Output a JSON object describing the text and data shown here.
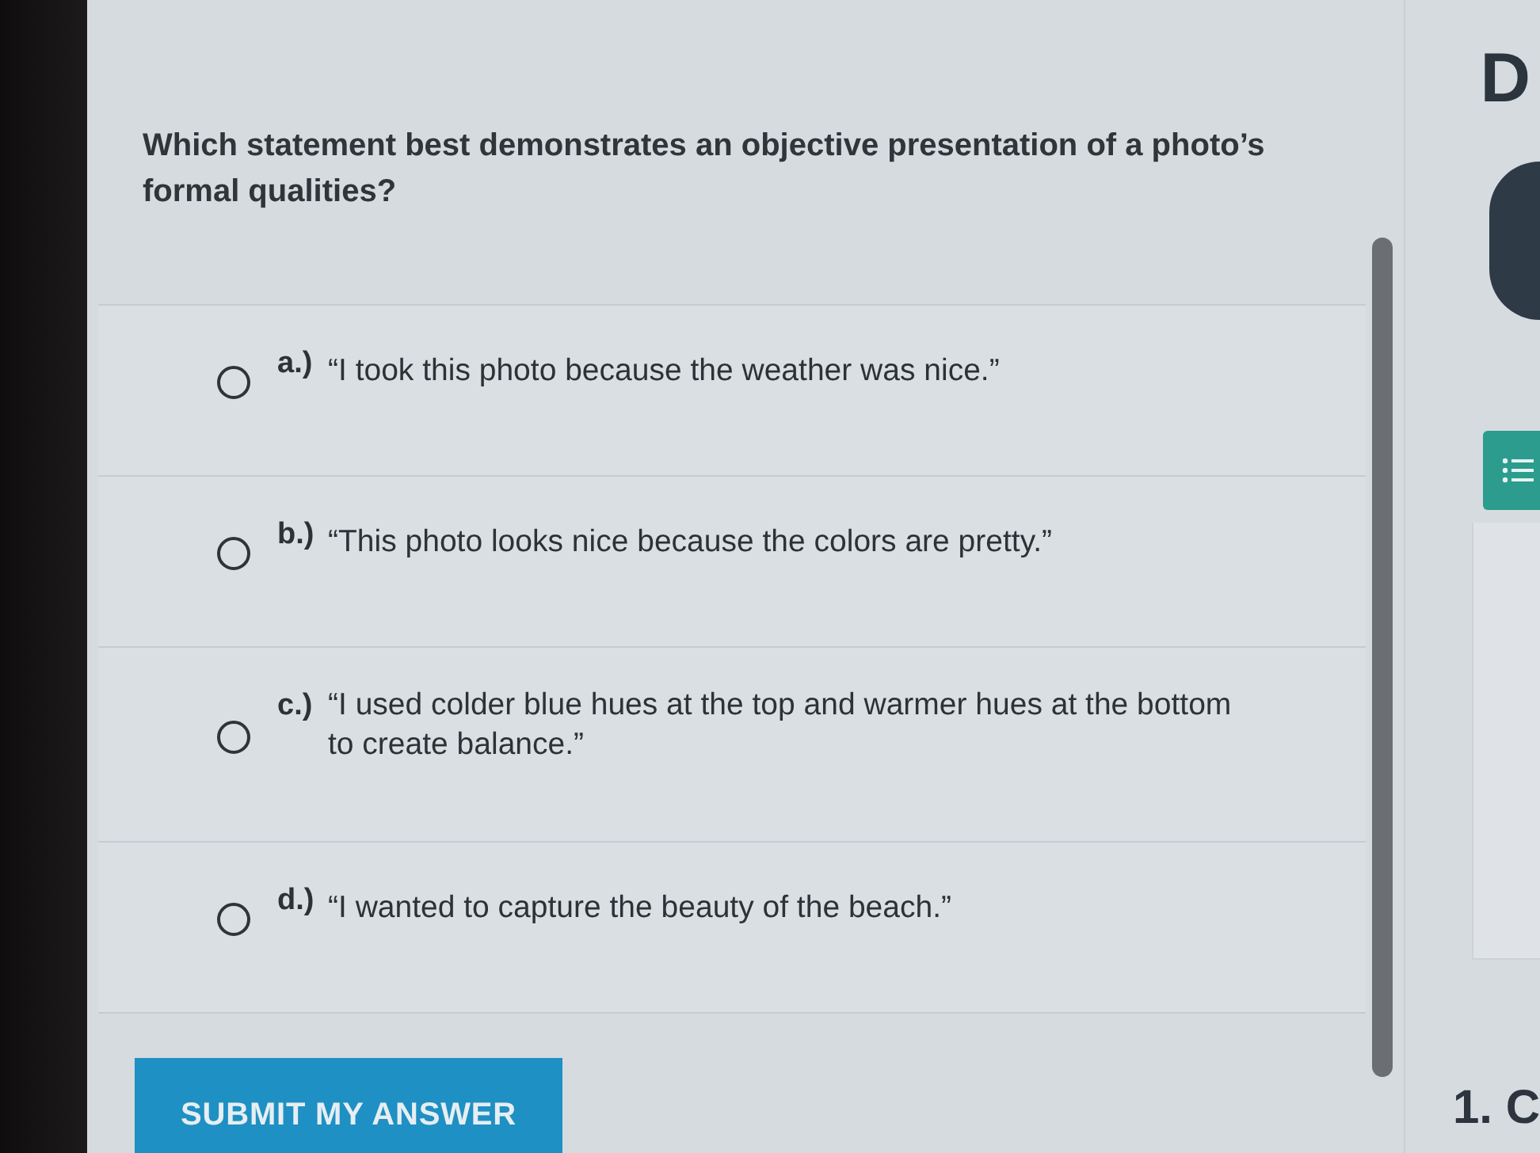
{
  "question": "Which statement best demonstrates an objective presentation of a photo’s formal qualities?",
  "options": [
    {
      "letter": "a.)",
      "text": "“I took this photo because the weather was nice.”",
      "selected": false
    },
    {
      "letter": "b.)",
      "text": "“This photo looks nice because the colors are pretty.”",
      "selected": false
    },
    {
      "letter": "c.)",
      "text": "“I used colder blue hues at the top and warmer hues at the bottom to create balance.”",
      "selected": false
    },
    {
      "letter": "d.)",
      "text": "“I wanted to capture the beauty of the beach.”",
      "selected": false
    }
  ],
  "submit_button": "SUBMIT MY ANSWER",
  "side": {
    "heading": "D",
    "footer": "1. C"
  }
}
